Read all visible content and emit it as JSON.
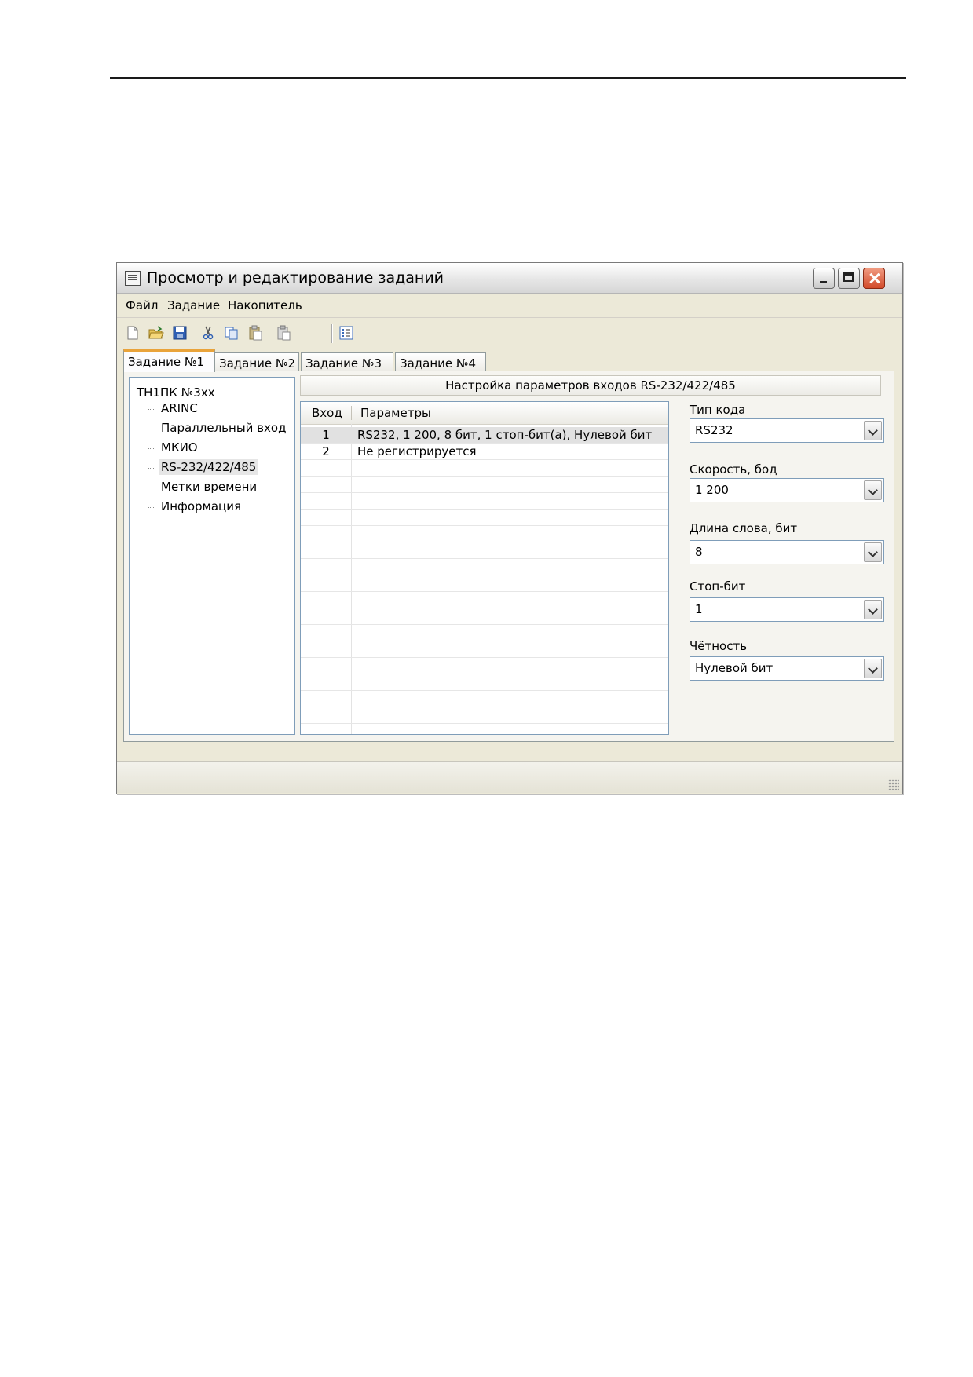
{
  "window": {
    "title": "Просмотр и редактирование заданий"
  },
  "menu": [
    "Файл",
    "Задание",
    "Накопитель"
  ],
  "toolbar": {
    "icons": [
      "new-file-icon",
      "open-folder-icon",
      "save-icon",
      "cut-icon",
      "copy-icon",
      "paste-icon",
      "paste-special-icon",
      "properties-icon"
    ]
  },
  "tabs": [
    "Задание №1",
    "Задание №2",
    "Задание №3",
    "Задание №4"
  ],
  "active_tab": 0,
  "tree": {
    "root": "ТН1ПК №3хх",
    "items": [
      "ARINC",
      "Параллельный вход",
      "МКИО",
      "RS-232/422/485",
      "Метки времени",
      "Информация"
    ],
    "selected": 3
  },
  "section": {
    "title": "Настройка параметров входов RS-232/422/485"
  },
  "grid": {
    "columns": [
      "Вход",
      "Параметры"
    ],
    "rows": [
      {
        "input": "1",
        "params": "RS232, 1 200, 8 бит, 1 стоп-бит(а), Нулевой бит"
      },
      {
        "input": "2",
        "params": "Не регистрируется"
      }
    ],
    "selected_row": 0
  },
  "settings": {
    "code_type": {
      "label": "Тип кода",
      "value": "RS232"
    },
    "speed": {
      "label": "Скорость, бод",
      "value": "1 200"
    },
    "word_length": {
      "label": "Длина слова, бит",
      "value": "8"
    },
    "stop_bit": {
      "label": "Стоп-бит",
      "value": "1"
    },
    "parity": {
      "label": "Чётность",
      "value": "Нулевой бит"
    }
  },
  "colors": {
    "active_tab_accent": "#e9a33a",
    "close_button": "#d24a2a",
    "field_border": "#7f9db9"
  }
}
